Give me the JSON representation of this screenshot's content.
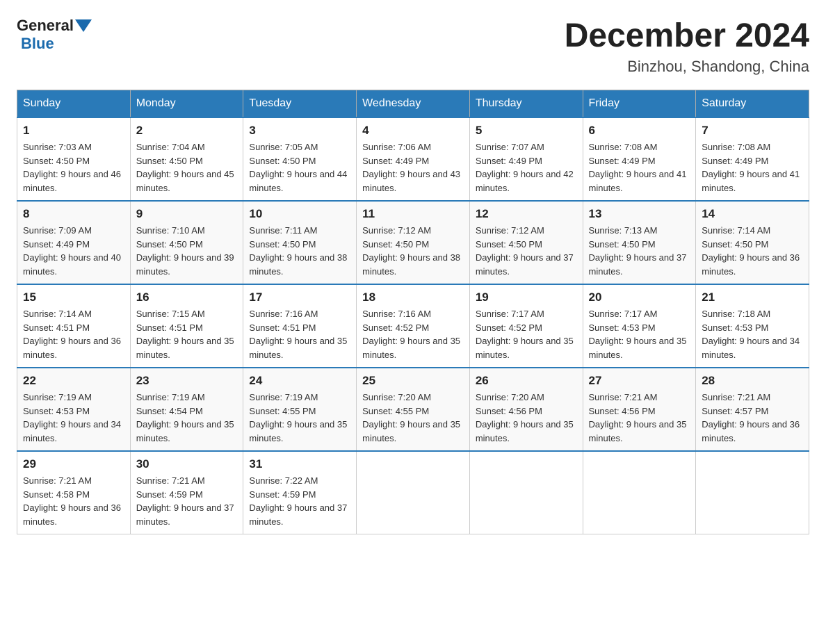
{
  "header": {
    "logo_general": "General",
    "logo_blue": "Blue",
    "month_title": "December 2024",
    "location": "Binzhou, Shandong, China"
  },
  "days_of_week": [
    "Sunday",
    "Monday",
    "Tuesday",
    "Wednesday",
    "Thursday",
    "Friday",
    "Saturday"
  ],
  "weeks": [
    [
      {
        "day": "1",
        "sunrise": "7:03 AM",
        "sunset": "4:50 PM",
        "daylight": "9 hours and 46 minutes."
      },
      {
        "day": "2",
        "sunrise": "7:04 AM",
        "sunset": "4:50 PM",
        "daylight": "9 hours and 45 minutes."
      },
      {
        "day": "3",
        "sunrise": "7:05 AM",
        "sunset": "4:50 PM",
        "daylight": "9 hours and 44 minutes."
      },
      {
        "day": "4",
        "sunrise": "7:06 AM",
        "sunset": "4:49 PM",
        "daylight": "9 hours and 43 minutes."
      },
      {
        "day": "5",
        "sunrise": "7:07 AM",
        "sunset": "4:49 PM",
        "daylight": "9 hours and 42 minutes."
      },
      {
        "day": "6",
        "sunrise": "7:08 AM",
        "sunset": "4:49 PM",
        "daylight": "9 hours and 41 minutes."
      },
      {
        "day": "7",
        "sunrise": "7:08 AM",
        "sunset": "4:49 PM",
        "daylight": "9 hours and 41 minutes."
      }
    ],
    [
      {
        "day": "8",
        "sunrise": "7:09 AM",
        "sunset": "4:49 PM",
        "daylight": "9 hours and 40 minutes."
      },
      {
        "day": "9",
        "sunrise": "7:10 AM",
        "sunset": "4:50 PM",
        "daylight": "9 hours and 39 minutes."
      },
      {
        "day": "10",
        "sunrise": "7:11 AM",
        "sunset": "4:50 PM",
        "daylight": "9 hours and 38 minutes."
      },
      {
        "day": "11",
        "sunrise": "7:12 AM",
        "sunset": "4:50 PM",
        "daylight": "9 hours and 38 minutes."
      },
      {
        "day": "12",
        "sunrise": "7:12 AM",
        "sunset": "4:50 PM",
        "daylight": "9 hours and 37 minutes."
      },
      {
        "day": "13",
        "sunrise": "7:13 AM",
        "sunset": "4:50 PM",
        "daylight": "9 hours and 37 minutes."
      },
      {
        "day": "14",
        "sunrise": "7:14 AM",
        "sunset": "4:50 PM",
        "daylight": "9 hours and 36 minutes."
      }
    ],
    [
      {
        "day": "15",
        "sunrise": "7:14 AM",
        "sunset": "4:51 PM",
        "daylight": "9 hours and 36 minutes."
      },
      {
        "day": "16",
        "sunrise": "7:15 AM",
        "sunset": "4:51 PM",
        "daylight": "9 hours and 35 minutes."
      },
      {
        "day": "17",
        "sunrise": "7:16 AM",
        "sunset": "4:51 PM",
        "daylight": "9 hours and 35 minutes."
      },
      {
        "day": "18",
        "sunrise": "7:16 AM",
        "sunset": "4:52 PM",
        "daylight": "9 hours and 35 minutes."
      },
      {
        "day": "19",
        "sunrise": "7:17 AM",
        "sunset": "4:52 PM",
        "daylight": "9 hours and 35 minutes."
      },
      {
        "day": "20",
        "sunrise": "7:17 AM",
        "sunset": "4:53 PM",
        "daylight": "9 hours and 35 minutes."
      },
      {
        "day": "21",
        "sunrise": "7:18 AM",
        "sunset": "4:53 PM",
        "daylight": "9 hours and 34 minutes."
      }
    ],
    [
      {
        "day": "22",
        "sunrise": "7:19 AM",
        "sunset": "4:53 PM",
        "daylight": "9 hours and 34 minutes."
      },
      {
        "day": "23",
        "sunrise": "7:19 AM",
        "sunset": "4:54 PM",
        "daylight": "9 hours and 35 minutes."
      },
      {
        "day": "24",
        "sunrise": "7:19 AM",
        "sunset": "4:55 PM",
        "daylight": "9 hours and 35 minutes."
      },
      {
        "day": "25",
        "sunrise": "7:20 AM",
        "sunset": "4:55 PM",
        "daylight": "9 hours and 35 minutes."
      },
      {
        "day": "26",
        "sunrise": "7:20 AM",
        "sunset": "4:56 PM",
        "daylight": "9 hours and 35 minutes."
      },
      {
        "day": "27",
        "sunrise": "7:21 AM",
        "sunset": "4:56 PM",
        "daylight": "9 hours and 35 minutes."
      },
      {
        "day": "28",
        "sunrise": "7:21 AM",
        "sunset": "4:57 PM",
        "daylight": "9 hours and 36 minutes."
      }
    ],
    [
      {
        "day": "29",
        "sunrise": "7:21 AM",
        "sunset": "4:58 PM",
        "daylight": "9 hours and 36 minutes."
      },
      {
        "day": "30",
        "sunrise": "7:21 AM",
        "sunset": "4:59 PM",
        "daylight": "9 hours and 37 minutes."
      },
      {
        "day": "31",
        "sunrise": "7:22 AM",
        "sunset": "4:59 PM",
        "daylight": "9 hours and 37 minutes."
      },
      null,
      null,
      null,
      null
    ]
  ],
  "labels": {
    "sunrise": "Sunrise:",
    "sunset": "Sunset:",
    "daylight": "Daylight:"
  }
}
